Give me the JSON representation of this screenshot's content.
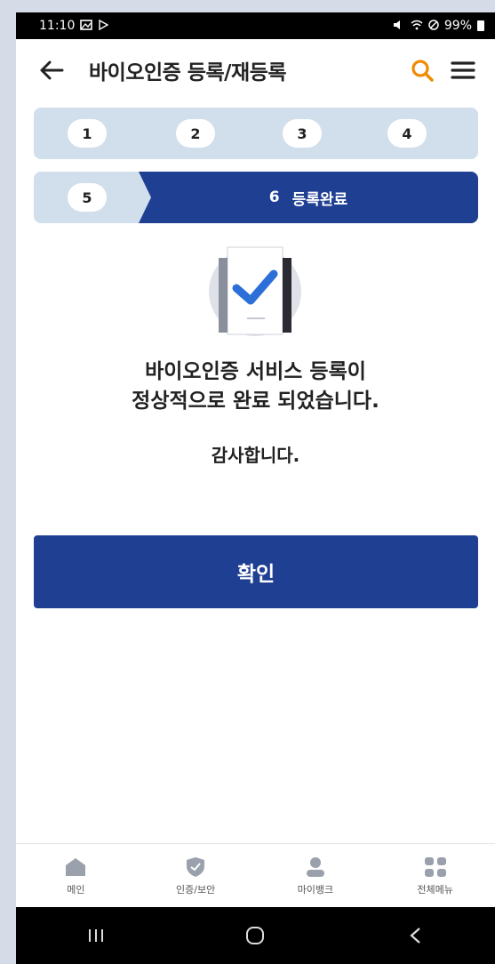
{
  "status_bar": {
    "time": "11:10",
    "battery": "99%"
  },
  "header": {
    "title": "바이오인증 등록/재등록"
  },
  "steps": {
    "row1": [
      "1",
      "2",
      "3",
      "4"
    ],
    "row2_first": "5",
    "active_number": "6",
    "active_label": "등록완료"
  },
  "message": {
    "line1": "바이오인증 서비스 등록이",
    "line2": "정상적으로 완료 되었습니다.",
    "thanks": "감사합니다."
  },
  "confirm_label": "확인",
  "bottom_nav": [
    {
      "label": "메인",
      "icon": "home-icon"
    },
    {
      "label": "인증/보안",
      "icon": "shield-icon"
    },
    {
      "label": "마이뱅크",
      "icon": "person-icon"
    },
    {
      "label": "전체메뉴",
      "icon": "grid-icon"
    }
  ],
  "colors": {
    "primary": "#1f3f92",
    "step_bg": "#d1deec",
    "search": "#f08a00",
    "nav_icon": "#9aa1ad"
  }
}
